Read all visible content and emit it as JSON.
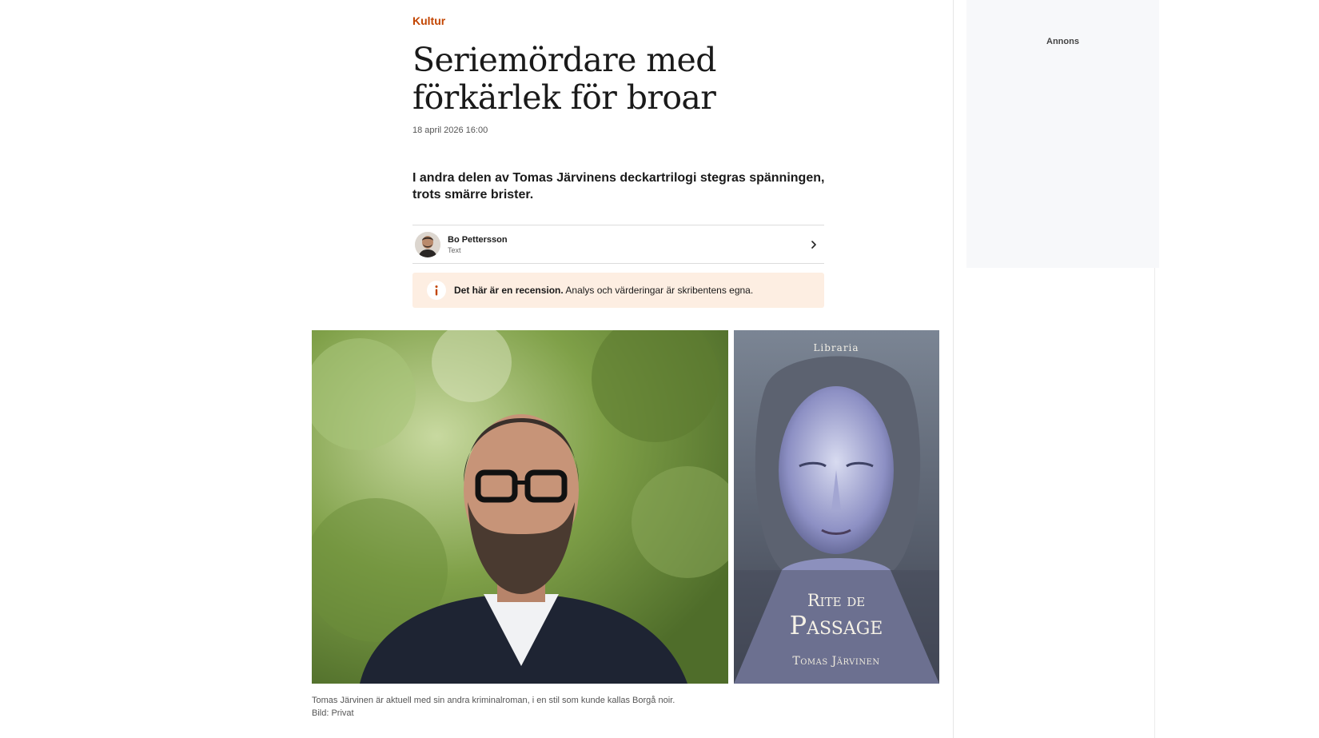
{
  "article": {
    "section": "Kultur",
    "headline": "Seriemördare med förkärlek för broar",
    "date": "18 april 2026 16:00",
    "lead": "I andra delen av Tomas Järvinens deckartrilogi stegras spänningen, trots smärre brister.",
    "author": {
      "name": "Bo Pettersson",
      "role": "Text"
    },
    "notice": {
      "bold": "Det här är en recension.",
      "text": " Analys och värderingar är skribentens egna."
    },
    "caption": {
      "text": "Tomas Järvinen är aktuell med sin andra kriminalroman, i en stil som kunde kallas Borgå noir.",
      "credit": "Bild: Privat"
    }
  },
  "book_cover": {
    "publisher": "Libraria",
    "title_line1": "Rite de",
    "title_line2": "Passage",
    "author": "Tomas Järvinen"
  },
  "ad": {
    "label": "Annons"
  },
  "colors": {
    "accent": "#c24400",
    "notice_bg": "#fdeee2",
    "ad_bg": "#f7f8fa"
  },
  "icons": {
    "byline_chevron": "chevron-right-icon",
    "notice": "info-icon"
  }
}
